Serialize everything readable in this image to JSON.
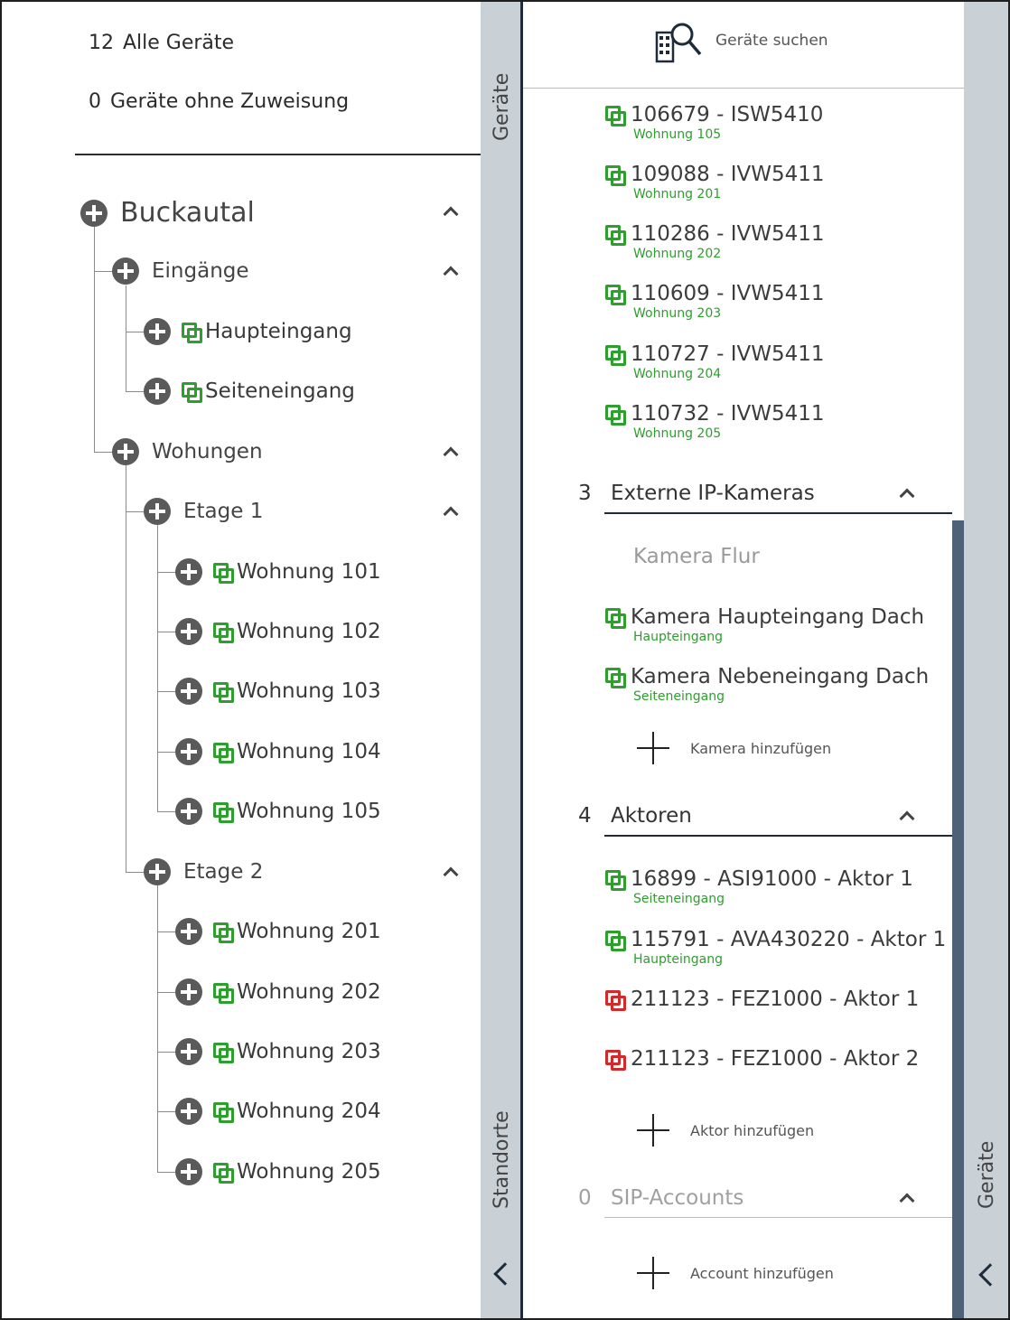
{
  "summary": {
    "all": {
      "count": "12",
      "label": "Alle Geräte"
    },
    "unassigned": {
      "count": "0",
      "label": "Geräte ohne Zuweisung"
    }
  },
  "tree": {
    "root": "Buckautal",
    "entrances": {
      "label": "Eingänge",
      "items": [
        "Haupteingang",
        "Seiteneingang"
      ]
    },
    "apartments": {
      "label": "Wohungen",
      "floors": [
        {
          "label": "Etage 1",
          "items": [
            "Wohnung 101",
            "Wohnung 102",
            "Wohnung 103",
            "Wohnung 104",
            "Wohnung 105"
          ]
        },
        {
          "label": "Etage 2",
          "items": [
            "Wohnung 201",
            "Wohnung 202",
            "Wohnung 203",
            "Wohnung 204",
            "Wohnung 205"
          ]
        }
      ]
    }
  },
  "tabs": {
    "left_devices": "Geräte",
    "locations": "Standorte",
    "right_devices": "Geräte"
  },
  "search": {
    "label": "Geräte suchen"
  },
  "devices": [
    {
      "name": "106679 - ISW5410",
      "location": "Wohnung 105"
    },
    {
      "name": "109088 - IVW5411",
      "location": "Wohnung 201"
    },
    {
      "name": "110286 - IVW5411",
      "location": "Wohnung 202"
    },
    {
      "name": "110609 - IVW5411",
      "location": "Wohnung 203"
    },
    {
      "name": "110727 - IVW5411",
      "location": "Wohnung 204"
    },
    {
      "name": "110732 - IVW5411",
      "location": "Wohnung 205"
    }
  ],
  "cameras": {
    "count": "3",
    "title": "Externe IP-Kameras",
    "items": [
      {
        "name": "Kamera Flur",
        "location": ""
      },
      {
        "name": "Kamera Haupteingang Dach",
        "location": "Haupteingang"
      },
      {
        "name": "Kamera Nebeneingang Dach",
        "location": "Seiteneingang"
      }
    ],
    "add_label": "Kamera hinzufügen"
  },
  "actors": {
    "count": "4",
    "title": "Aktoren",
    "items": [
      {
        "name": "16899 - ASI91000 - Aktor 1",
        "location": "Seiteneingang",
        "status": "ok"
      },
      {
        "name": "115791 - AVA430220 - Aktor 1",
        "location": "Haupteingang",
        "status": "ok"
      },
      {
        "name": "211123 - FEZ1000 - Aktor 1",
        "location": "",
        "status": "error"
      },
      {
        "name": "211123 - FEZ1000 - Aktor 2",
        "location": "",
        "status": "error"
      }
    ],
    "add_label": "Aktor hinzufügen"
  },
  "sip": {
    "count": "0",
    "title": "SIP-Accounts",
    "add_label": "Account hinzufügen"
  },
  "colors": {
    "linked": "#2e9e2e",
    "error": "#d12a2a",
    "tab_bg": "#c9d0d6",
    "dark": "#1e2b3a"
  }
}
